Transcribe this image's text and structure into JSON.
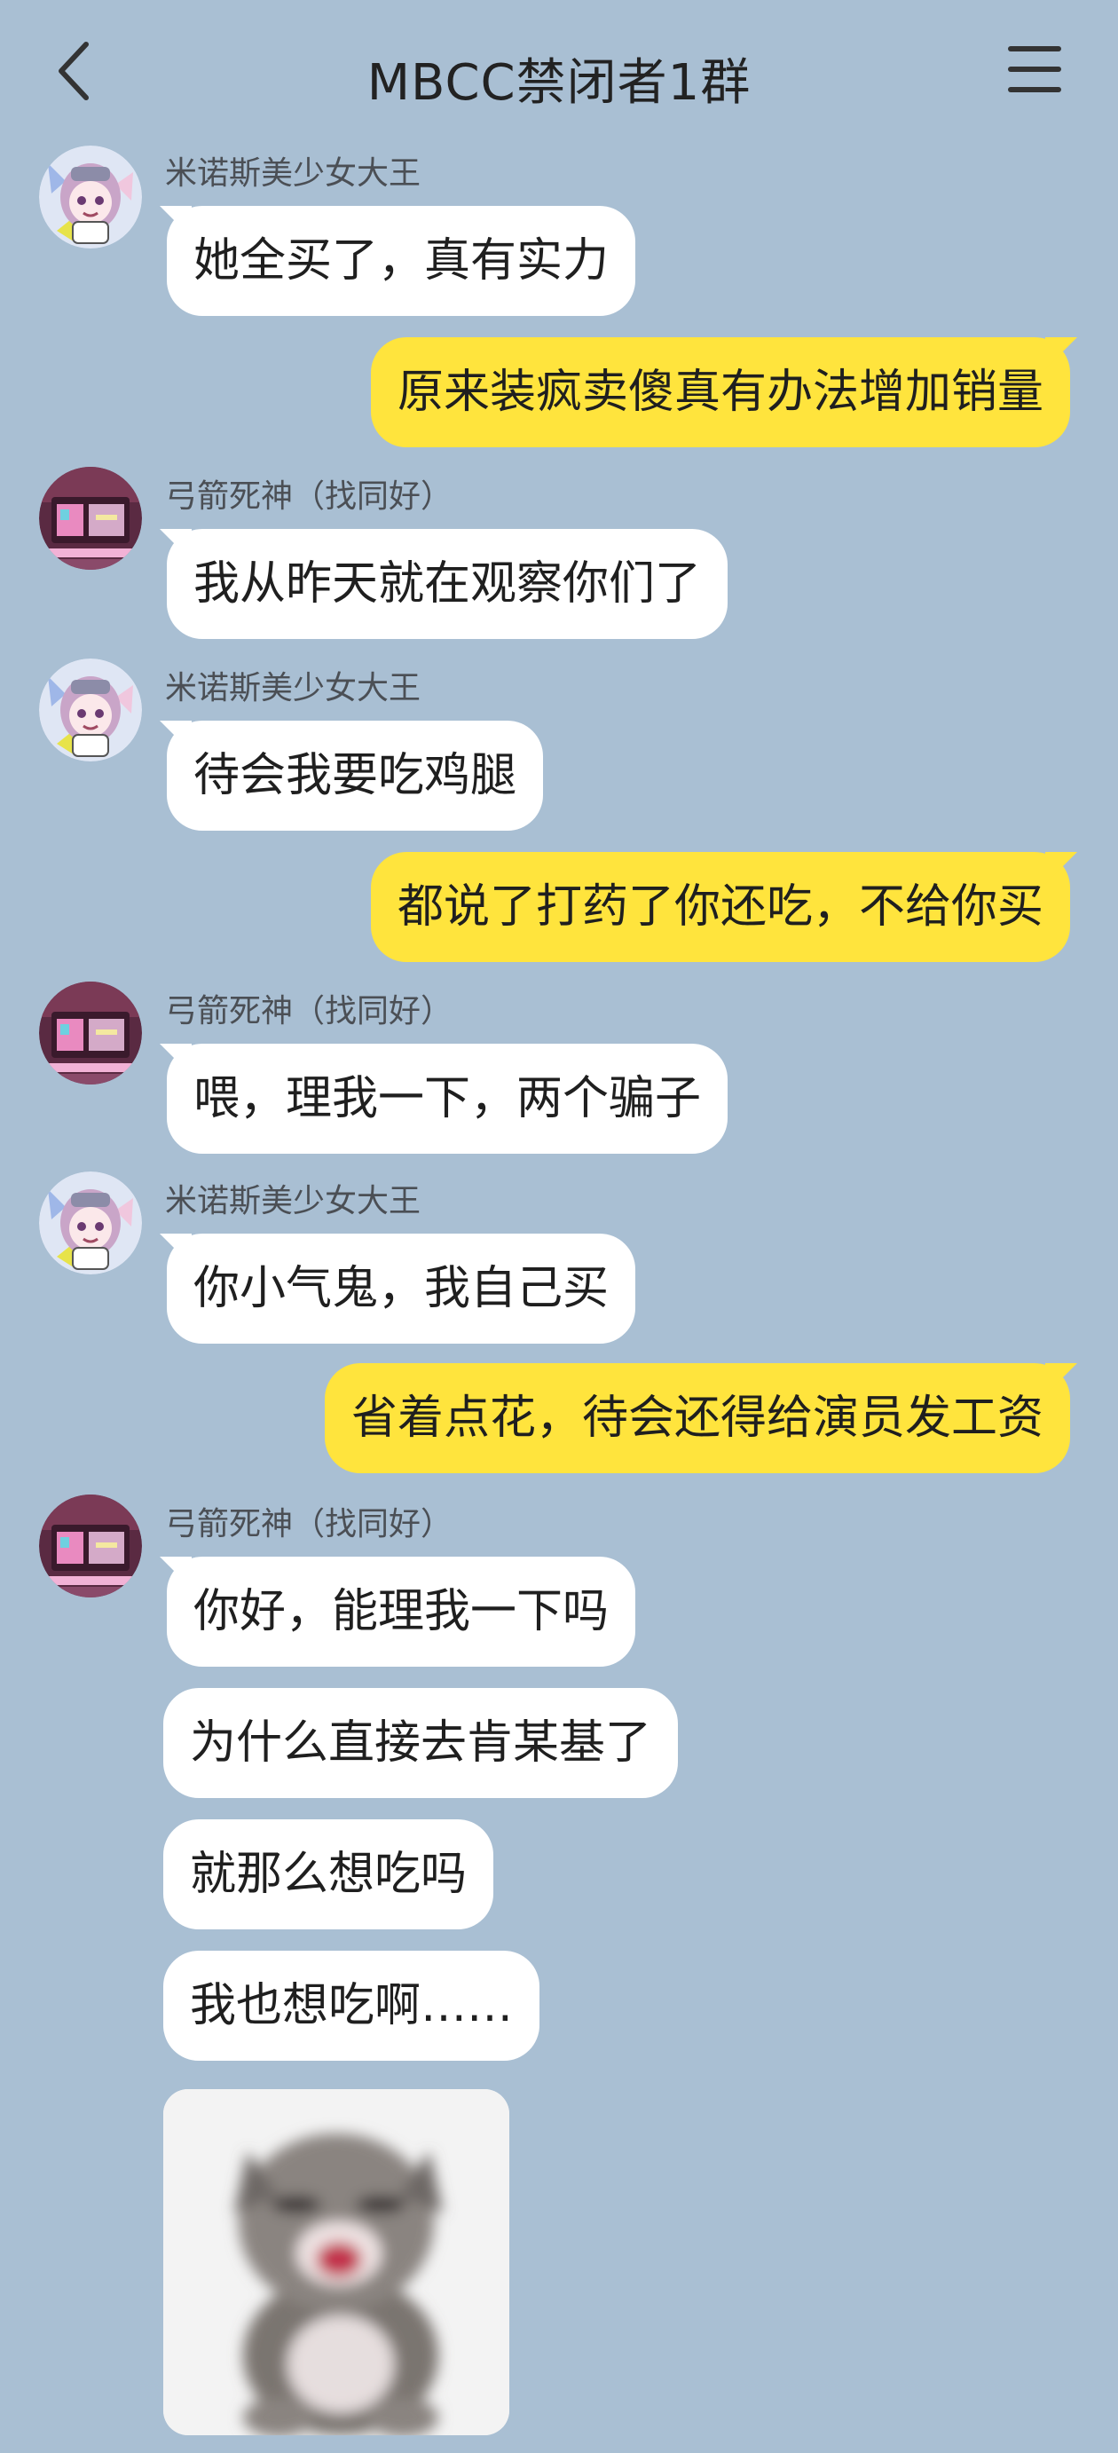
{
  "header": {
    "title": "MBCC禁闭者1群",
    "back_icon": "back-arrow-icon",
    "menu_icon": "menu-icon"
  },
  "users": {
    "mino": "米诺斯美少女大王",
    "archer": "弓箭死神（找同好）"
  },
  "messages": [
    {
      "id": "m1",
      "side": "left",
      "sender": "米诺斯美少女大王",
      "text": "她全买了，真有实力"
    },
    {
      "id": "m2",
      "side": "right",
      "text": "原来装疯卖傻真有办法增加销量"
    },
    {
      "id": "m3",
      "side": "left",
      "sender": "弓箭死神（找同好）",
      "text": "我从昨天就在观察你们了"
    },
    {
      "id": "m4",
      "side": "left",
      "sender": "米诺斯美少女大王",
      "text": "待会我要吃鸡腿"
    },
    {
      "id": "m5",
      "side": "right",
      "text": "都说了打药了你还吃，不给你买"
    },
    {
      "id": "m6",
      "side": "left",
      "sender": "弓箭死神（找同好）",
      "text": "喂，理我一下，两个骗子"
    },
    {
      "id": "m7",
      "side": "left",
      "sender": "米诺斯美少女大王",
      "text": "你小气鬼，我自己买"
    },
    {
      "id": "m8",
      "side": "right",
      "text": "省着点花，待会还得给演员发工资"
    },
    {
      "id": "m9",
      "side": "left",
      "sender": "弓箭死神（找同好）",
      "text": "你好，能理我一下吗"
    },
    {
      "id": "m10",
      "side": "left",
      "text": "为什么直接去肯某基了"
    },
    {
      "id": "m11",
      "side": "left",
      "text": "就那么想吃吗"
    },
    {
      "id": "m12",
      "side": "left",
      "text": "我也想吃啊……"
    }
  ],
  "sticker": {
    "icon": "crying-cat-sticker"
  },
  "colors": {
    "background": "#a9bfd3",
    "incoming_bubble": "#ffffff",
    "outgoing_bubble": "#ffe43d"
  }
}
